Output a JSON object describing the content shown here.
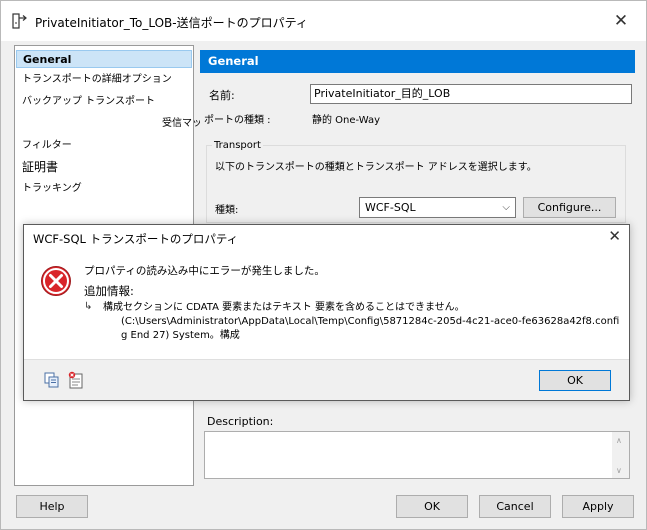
{
  "window": {
    "title": "PrivateInitiator_To_LOB-送信ポートのプロパティ",
    "close_glyph": "✕"
  },
  "nav": {
    "items": [
      {
        "label": "General"
      },
      {
        "label": "トランスポートの詳細オプション"
      },
      {
        "label": "バックアップ トランスポート"
      },
      {
        "label": "受信マップ"
      },
      {
        "label": "フィルター"
      },
      {
        "label": "証明書"
      },
      {
        "label": "トラッキング"
      }
    ]
  },
  "panel": {
    "header": "General",
    "name_label": "名前:",
    "name_value": "PrivateInitiator_目的_LOB",
    "port_type_label": "ポートの種類 :",
    "port_type_value": "静的 One-Way",
    "transport_title": "Transport",
    "transport_desc": "以下のトランスポートの種類とトランスポート アドレスを選択します。",
    "type_label": "種類:",
    "type_value": "WCF-SQL",
    "configure_button": "Configure...",
    "description_label": "Description:",
    "description_value": ""
  },
  "footer": {
    "help": "Help",
    "ok": "OK",
    "cancel": "Cancel",
    "apply": "Apply"
  },
  "error_dialog": {
    "title": "WCF-SQL トランスポートのプロパティ",
    "close_glyph": "✕",
    "message": "プロパティの読み込み中にエラーが発生しました。",
    "additional_label": "追加情報:",
    "arrow_glyph": "↳",
    "detail_lines": [
      "構成セクションに CDATA 要素またはテキスト 要素を含めることはできません。",
      "(C:\\Users\\Administrator\\AppData\\Local\\Temp\\Config\\5871284c-205d-4c21-ace0-fe63628a42f8.confi",
      "g End 27) System。構成"
    ],
    "ok_button": "OK"
  },
  "colors": {
    "accent": "#0078d7",
    "selection": "#cce4f7",
    "error_red": "#d9252a"
  }
}
